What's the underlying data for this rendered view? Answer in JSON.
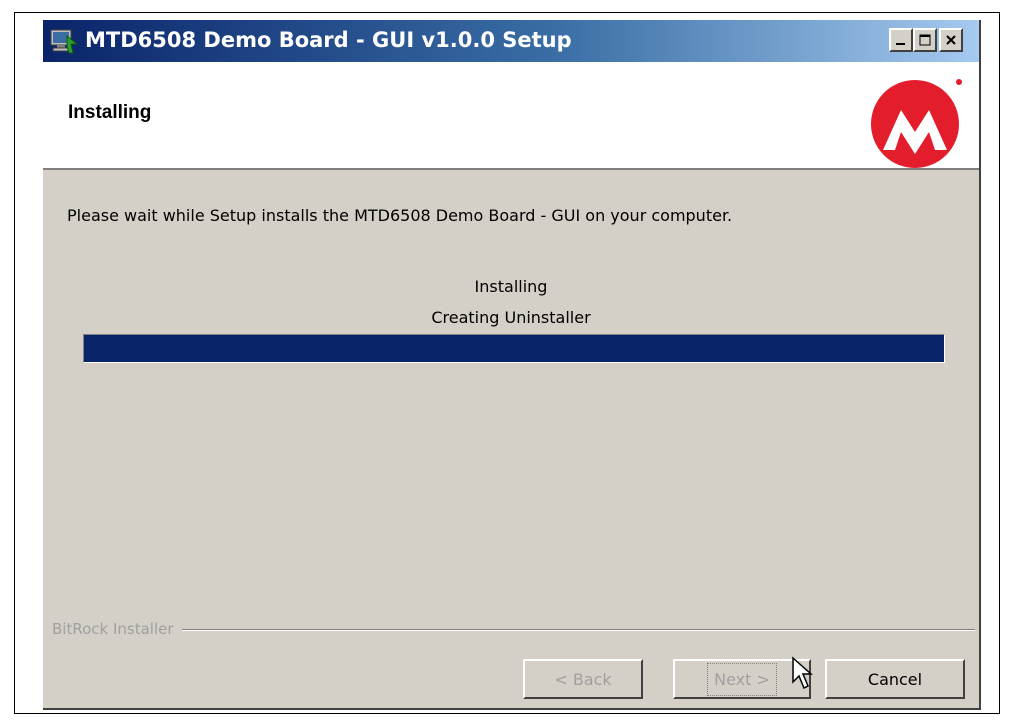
{
  "window": {
    "title": "MTD6508 Demo Board - GUI v1.0.0 Setup",
    "controls": [
      "minimize-icon",
      "maximize-icon",
      "close-icon"
    ]
  },
  "header": {
    "title": "Installing",
    "logo": "microchip-logo"
  },
  "body": {
    "description": "Please wait while Setup installs the MTD6508 Demo Board - GUI on your computer.",
    "status_line1": "Installing",
    "status_line2": "Creating Uninstaller",
    "progress_fraction": 1.0
  },
  "footer": {
    "brand_label": "BitRock Installer",
    "back_label": "< Back",
    "next_label": "Next >",
    "cancel_label": "Cancel"
  },
  "colors": {
    "titlebar_start": "#0a246a",
    "titlebar_end": "#a6caf0",
    "progress_fill": "#0a246a",
    "dialog_face": "#d4d0c8",
    "logo_red": "#e41d2d"
  }
}
